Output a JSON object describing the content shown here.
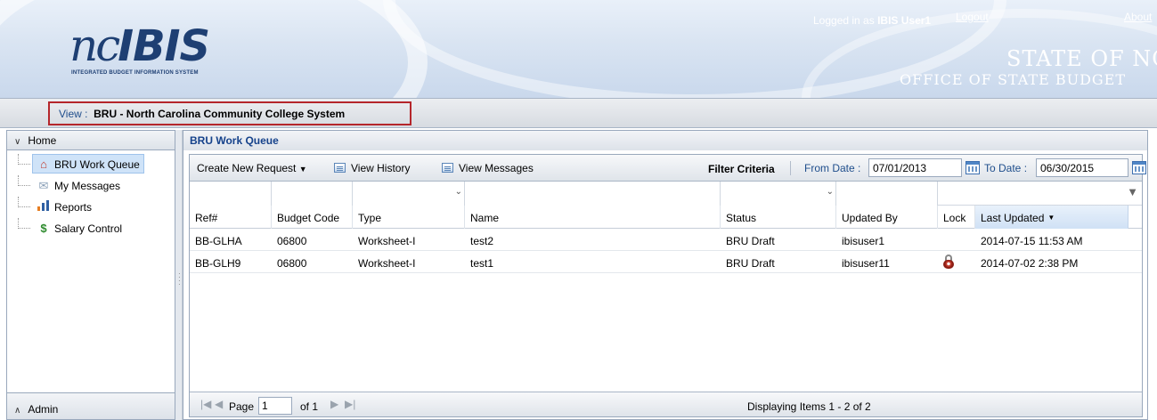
{
  "header": {
    "logo_nc": "nc",
    "logo_ibis": "IBIS",
    "logo_subtitle": "INTEGRATED BUDGET INFORMATION SYSTEM",
    "logged_in_prefix": "Logged in as",
    "logged_in_user": "IBIS User1",
    "logout_label": "Logout",
    "about_label": "About",
    "state_title": "STATE OF NO",
    "office_title": "OFFICE OF STATE BUDGET"
  },
  "viewbar": {
    "label": "View :",
    "value": "BRU - North Carolina Community College System"
  },
  "sidebar": {
    "section_home": "Home",
    "section_admin": "Admin",
    "items": [
      {
        "label": "BRU Work Queue",
        "icon": "home-icon",
        "selected": true
      },
      {
        "label": "My Messages",
        "icon": "envelope-icon",
        "selected": false
      },
      {
        "label": "Reports",
        "icon": "bar-chart-icon",
        "selected": false
      },
      {
        "label": "Salary Control",
        "icon": "dollar-icon",
        "selected": false
      }
    ]
  },
  "main": {
    "panel_title": "BRU Work Queue",
    "toolbar": {
      "create_label": "Create New Request",
      "history_label": "View History",
      "messages_label": "View Messages",
      "filter_label": "Filter Criteria",
      "from_label": "From Date :",
      "from_value": "07/01/2013",
      "to_label": "To Date :",
      "to_value": "06/30/2015"
    },
    "columns": [
      "Ref#",
      "Budget Code",
      "Type",
      "Name",
      "Status",
      "Updated By",
      "Lock",
      "Last Updated"
    ],
    "rows": [
      [
        "BB-GLHA",
        "06800",
        "Worksheet-I",
        "test2",
        "BRU Draft",
        "ibisuser1",
        "",
        "2014-07-15 11:53 AM"
      ],
      [
        "BB-GLH9",
        "06800",
        "Worksheet-I",
        "test1",
        "BRU Draft",
        "ibisuser11",
        "locked",
        "2014-07-02 2:38 PM"
      ]
    ],
    "pager": {
      "page_label": "Page",
      "page_value": "1",
      "of_label": "of 1",
      "display_text": "Displaying Items 1 - 2 of 2"
    }
  },
  "colors": {
    "brand_blue": "#1e3f73",
    "highlight_red": "#b5262b",
    "selected_bg": "#cfe3f8"
  }
}
